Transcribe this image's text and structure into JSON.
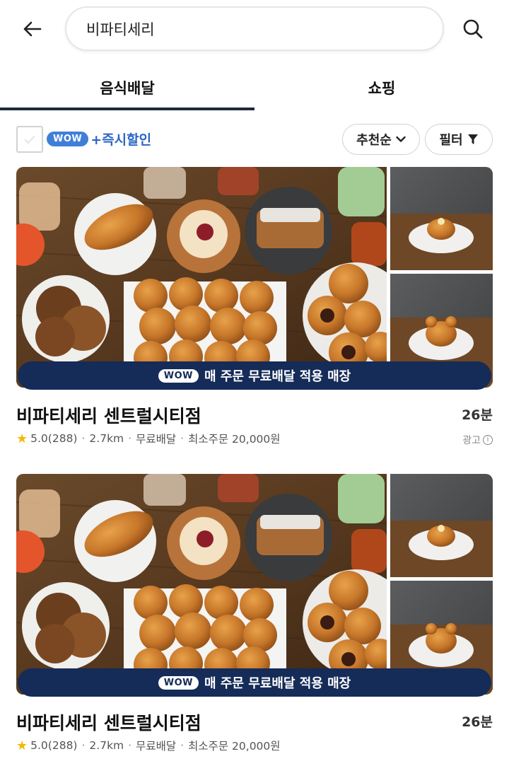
{
  "header": {
    "search_value": "비파티세리",
    "back_icon": "arrow-left-icon",
    "search_icon": "search-icon"
  },
  "tabs": [
    {
      "label": "음식배달",
      "active": true
    },
    {
      "label": "쇼핑",
      "active": false
    }
  ],
  "filters": {
    "wow_badge": "WOW",
    "instant_discount": "+즉시할인",
    "sort_label": "추천순",
    "filter_label": "필터"
  },
  "stores": [
    {
      "promo_badge": "WOW",
      "promo_text": "매 주문 무료배달 적용 매장",
      "name": "비파티세리 센트럴시티점",
      "eta": "26분",
      "rating": "5.0",
      "reviews": "(288)",
      "distance": "2.7km",
      "delivery": "무료배달",
      "min_order": "최소주문 20,000원",
      "ad_label": "광고"
    },
    {
      "promo_badge": "WOW",
      "promo_text": "매 주문 무료배달 적용 매장",
      "name": "비파티세리 센트럴시티점",
      "eta": "26분",
      "rating": "5.0",
      "reviews": "(288)",
      "distance": "2.7km",
      "delivery": "무료배달",
      "min_order": "최소주문 20,000원"
    }
  ],
  "colors": {
    "wow_blue": "#3f7fd8",
    "promo_navy": "#152b58",
    "star": "#f5b800",
    "tab_underline": "#1d2a3a"
  }
}
